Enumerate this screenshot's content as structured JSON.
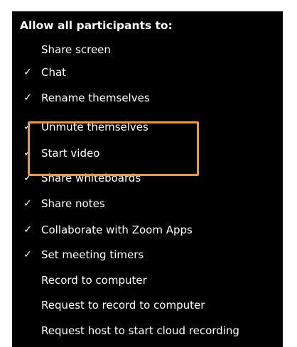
{
  "menu": {
    "header": "Allow all participants to:",
    "check_glyph": "✓",
    "items": [
      {
        "label": "Share screen",
        "checked": false
      },
      {
        "label": "Chat",
        "checked": true
      },
      {
        "label": "Rename themselves",
        "checked": true
      },
      {
        "label": "Unmute themselves",
        "checked": true
      },
      {
        "label": "Start video",
        "checked": true
      },
      {
        "label": "Share whiteboards",
        "checked": true
      },
      {
        "label": "Share notes",
        "checked": true
      },
      {
        "label": "Collaborate with Zoom Apps",
        "checked": true
      },
      {
        "label": "Set meeting timers",
        "checked": true
      },
      {
        "label": "Record to computer",
        "checked": false
      },
      {
        "label": "Request to record to computer",
        "checked": false
      },
      {
        "label": "Request host to start cloud recording",
        "checked": false
      }
    ]
  },
  "colors": {
    "menu_background": "#000000",
    "text": "#ffffff",
    "highlight": "#f59a1b"
  }
}
